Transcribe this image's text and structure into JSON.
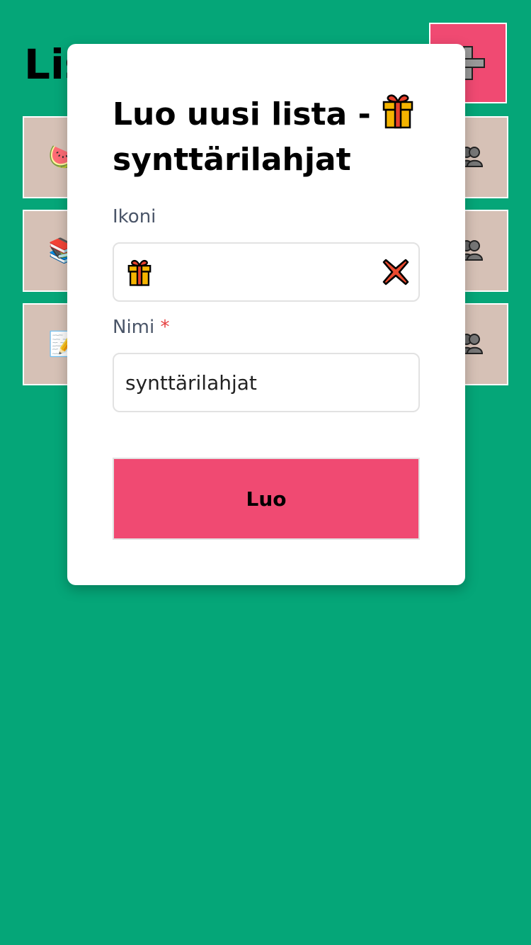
{
  "background": {
    "page_title": "Listat",
    "add_button_label": "+",
    "rows": [
      {
        "icon": "🍉",
        "icon_name": "watermelon-icon"
      },
      {
        "icon": "📚",
        "icon_name": "books-icon"
      },
      {
        "icon": "📝",
        "icon_name": "memo-icon"
      }
    ],
    "row_trailing_icon": "people-icon"
  },
  "modal": {
    "title_text": "Luo uusi lista - ",
    "title_emoji": "gift-icon",
    "title_name": "synttärilahjat",
    "icon_field": {
      "label": "Ikoni",
      "value": "gift-icon",
      "clear_icon": "close-x-icon"
    },
    "name_field": {
      "label": "Nimi",
      "required_mark": "*",
      "value": "synttärilahjat"
    },
    "submit_label": "Luo"
  },
  "colors": {
    "background": "#05a678",
    "accent": "#f04a72",
    "row": "#d6c1b6",
    "label": "#4a5568",
    "required": "#e53e3e"
  }
}
